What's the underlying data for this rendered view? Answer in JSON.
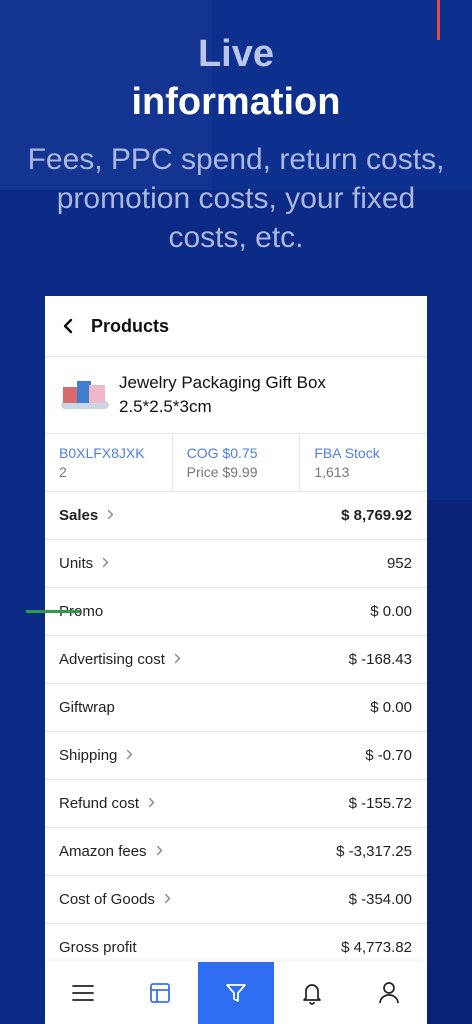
{
  "hero": {
    "line1": "Live",
    "line2": "information",
    "subtitle": "Fees, PPC spend, return costs, promotion costs, your fixed costs, etc."
  },
  "header": {
    "title": "Products",
    "back_icon": "chevron-left-icon"
  },
  "product": {
    "name": "Jewelry Packaging Gift Box 2.5*2.5*3cm"
  },
  "info": {
    "asin": "B0XLFX8JXK",
    "asin_sub": "2",
    "cog": "COG $0.75",
    "price": "Price $9.99",
    "fba_label": "FBA Stock",
    "fba_value": "1,613"
  },
  "rows": [
    {
      "label": "Sales",
      "value": "$ 8,769.92",
      "chevron": true,
      "bold": true
    },
    {
      "label": "Units",
      "value": "952",
      "chevron": true,
      "bold": false
    },
    {
      "label": "Promo",
      "value": "$ 0.00",
      "chevron": false,
      "bold": false
    },
    {
      "label": "Advertising cost",
      "value": "$ -168.43",
      "chevron": true,
      "bold": false
    },
    {
      "label": "Giftwrap",
      "value": "$ 0.00",
      "chevron": false,
      "bold": false
    },
    {
      "label": "Shipping",
      "value": "$ -0.70",
      "chevron": true,
      "bold": false
    },
    {
      "label": "Refund cost",
      "value": "$ -155.72",
      "chevron": true,
      "bold": false
    },
    {
      "label": "Amazon fees",
      "value": "$ -3,317.25",
      "chevron": true,
      "bold": false
    },
    {
      "label": "Cost of Goods",
      "value": "$ -354.00",
      "chevron": true,
      "bold": false
    },
    {
      "label": "Gross profit",
      "value": "$ 4,773.82",
      "chevron": false,
      "bold": false
    }
  ],
  "bottom_nav": [
    {
      "icon": "menu-icon",
      "active": false
    },
    {
      "icon": "dashboard-icon",
      "active": false
    },
    {
      "icon": "filter-icon",
      "active": true
    },
    {
      "icon": "bell-icon",
      "active": false
    },
    {
      "icon": "user-icon",
      "active": false
    }
  ],
  "colors": {
    "background": "#0b2a86",
    "accent": "#2f6df0",
    "link": "#4f7fe0",
    "marker_red": "#e8483b",
    "marker_green": "#2e9b49"
  }
}
